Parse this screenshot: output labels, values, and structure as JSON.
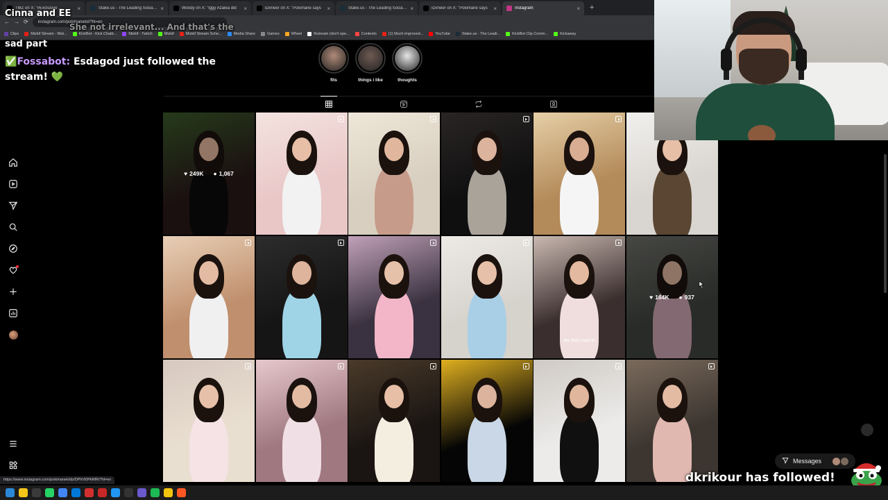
{
  "browser": {
    "tabs": [
      {
        "label": "TMZ on X: \"#Exclusive ...",
        "icon": "x-icon",
        "color": "#000000",
        "active": false
      },
      {
        "label": "Stake.us - The Leading Social C",
        "icon": "stake-icon",
        "color": "#1a2c38",
        "active": false
      },
      {
        "label": "Woody on X: \"Iggy Azalea did",
        "icon": "x-icon",
        "color": "#000000",
        "active": false
      },
      {
        "label": "iDvneer on X: \"Pokimane says",
        "icon": "x-icon",
        "color": "#000000",
        "active": false
      },
      {
        "label": "Stake.us - The Leading Social C",
        "icon": "stake-icon",
        "color": "#1a2c38",
        "active": false
      },
      {
        "label": "iDvneer on X: \"Pokimane says",
        "icon": "x-icon",
        "color": "#000000",
        "active": false
      },
      {
        "label": "Instagram",
        "icon": "instagram-icon",
        "color": "#c13584",
        "active": true
      }
    ],
    "address": "instagram.com/pokimanelol/?hl=en",
    "bookmarks": [
      {
        "label": "Clips",
        "color": "#6441a5"
      },
      {
        "label": "Mizkif Stream - Wat...",
        "color": "#e62117"
      },
      {
        "label": "KickBot - Kick Chatb...",
        "color": "#53fc18"
      },
      {
        "label": "Mizkif - Twitch",
        "color": "#9146ff"
      },
      {
        "label": "Mizkif",
        "color": "#53fc18"
      },
      {
        "label": "Mizkif Stream Sche...",
        "color": "#e62117"
      },
      {
        "label": "Media Share",
        "color": "#2b8cff"
      },
      {
        "label": "Games",
        "color": "#888888"
      },
      {
        "label": "Wheel",
        "color": "#f5a623"
      },
      {
        "label": "Rutream (don't ope...",
        "color": "#ffffff"
      },
      {
        "label": "Contexto",
        "color": "#ff4444"
      },
      {
        "label": "(1) Much improved...",
        "color": "#e62117"
      },
      {
        "label": "YouTube",
        "color": "#ff0000"
      },
      {
        "label": "Stake.us - The Leadi...",
        "color": "#1a2c38"
      },
      {
        "label": "KickBot Clip Comm...",
        "color": "#53fc18"
      },
      {
        "label": "Kickaway",
        "color": "#53fc18"
      }
    ],
    "status_url": "https://www.instagram.com/pokimanelol/p/DPhVi0PkRfR/?hl=en"
  },
  "overlay": {
    "line1": "Cinna and EE",
    "line_faint": "She not irrelevant... And that's the",
    "line2": "sad part",
    "bot_name": "Fossabot:",
    "bot_message": " Esdagod just followed the stream! ",
    "heart": "💚",
    "follow_alert": "dkrikour has followed!"
  },
  "highlights": [
    {
      "label": "fits",
      "color": "#b08a78"
    },
    {
      "label": "things i like",
      "color": "#6e5a52"
    },
    {
      "label": "thoughts",
      "color": "#e6e6e6"
    }
  ],
  "profile_tabs": [
    {
      "icon": "grid-icon",
      "active": true
    },
    {
      "icon": "reels-icon",
      "active": false
    },
    {
      "icon": "repost-icon",
      "active": false
    },
    {
      "icon": "tagged-icon",
      "active": false
    }
  ],
  "posts": [
    {
      "bg": "#2a1a1a",
      "accent": "#3a5a2a",
      "skin": "#e0b49a",
      "outfit": "#0c0c0c",
      "reel": false,
      "likes": "249K",
      "comments": "1,067"
    },
    {
      "bg": "#e9c7c7",
      "accent": "#f3e3df",
      "skin": "#e6bfa6",
      "outfit": "#f2f2f2",
      "reel": true
    },
    {
      "bg": "#d8cfc0",
      "accent": "#eee6d8",
      "skin": "#e0b79d",
      "outfit": "#c79b8a",
      "reel": true
    },
    {
      "bg": "#0f0f0f",
      "accent": "#2a2525",
      "skin": "#dcb39c",
      "outfit": "#a9a39a",
      "reel": true
    },
    {
      "bg": "#b38a5a",
      "accent": "#e6cfa6",
      "skin": "#d9ad92",
      "outfit": "#f5f5f5",
      "reel": true
    },
    {
      "bg": "#d9d5d0",
      "accent": "#f1f0ee",
      "skin": "#e6bfa6",
      "outfit": "#5a4632",
      "reel": false
    },
    {
      "bg": "#c08f6d",
      "accent": "#e8cfb6",
      "skin": "#e3bba3",
      "outfit": "#f0f0f0",
      "reel": true
    },
    {
      "bg": "#151515",
      "accent": "#2c2c2c",
      "skin": "#dfb49c",
      "outfit": "#9fd3e6",
      "reel": true
    },
    {
      "bg": "#3a3240",
      "accent": "#c0a0b8",
      "skin": "#e6c1a9",
      "outfit": "#f2b6c8",
      "reel": true
    },
    {
      "bg": "#d6d2cc",
      "accent": "#ede9e4",
      "skin": "#e6c0a8",
      "outfit": "#a9cfe6",
      "reel": true
    },
    {
      "bg": "#3a2e2e",
      "accent": "#c9b8b0",
      "skin": "#e3b9a0",
      "outfit": "#f0dede",
      "reel": true,
      "caption": "like that's hard to"
    },
    {
      "bg": "#40433f",
      "accent": "#6c6e68",
      "skin": "#d9b39c",
      "outfit": "#c9a2b0",
      "reel": false,
      "likes": "164K",
      "comments": "937"
    },
    {
      "bg": "#e9dfd0",
      "accent": "#d7c8c0",
      "skin": "#e6c0a8",
      "outfit": "#f6e3e6",
      "reel": true
    },
    {
      "bg": "#a07880",
      "accent": "#e6c8cc",
      "skin": "#e3bba3",
      "outfit": "#f0e0e6",
      "reel": true
    },
    {
      "bg": "#1a1512",
      "accent": "#4a3a2a",
      "skin": "#e6bfa6",
      "outfit": "#f3eee0",
      "reel": true
    },
    {
      "bg": "#050505",
      "accent": "#e0b020",
      "skin": "#dcb39c",
      "outfit": "#c9d7e6",
      "reel": true
    },
    {
      "bg": "#ecebea",
      "accent": "#cfcac4",
      "skin": "#e0b79d",
      "outfit": "#101010",
      "reel": true
    },
    {
      "bg": "#3c3530",
      "accent": "#7a6a5c",
      "skin": "#e3bba3",
      "outfit": "#e0b8b0",
      "reel": true
    }
  ],
  "messages": {
    "label": "Messages"
  },
  "taskbar": [
    "#2b88d8",
    "#f5c518",
    "#3a3a3a",
    "#25d366",
    "#4285f4",
    "#0078d7",
    "#d32f2f",
    "#c62828",
    "#2196f3",
    "#333333",
    "#6a5acd",
    "#1db954",
    "#f1c40f",
    "#ff5722"
  ]
}
